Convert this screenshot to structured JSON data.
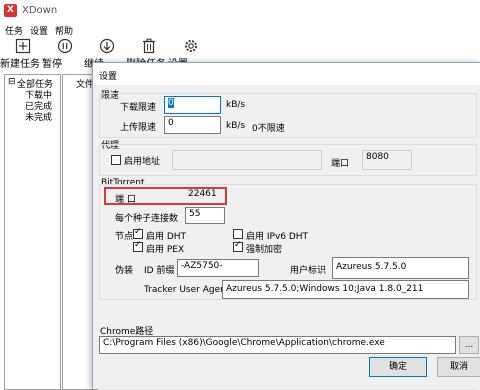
{
  "app": {
    "title": "XDown",
    "logo_letter": "X"
  },
  "menu": [
    "任务",
    "设置",
    "帮助"
  ],
  "toolbar": [
    {
      "label": "新建任务",
      "icon": "plus-icon"
    },
    {
      "label": "暂停",
      "icon": "pause-icon"
    },
    {
      "label": "继续",
      "icon": "download-icon"
    },
    {
      "label": "删除任务",
      "icon": "trash-icon"
    },
    {
      "label": "设置",
      "icon": "gear-icon"
    }
  ],
  "tree": {
    "root": "全部任务",
    "items": [
      "下载中",
      "已完成",
      "未完成"
    ]
  },
  "list": {
    "column_header": "文件"
  },
  "dialog": {
    "title": "设置",
    "speed_limit": {
      "group": "限速",
      "download_label": "下载限速",
      "download_value": "0",
      "download_unit": "kB/s",
      "upload_label": "上传限速",
      "upload_value": "0",
      "upload_unit": "kB/s",
      "unlimited_note": "0不限速"
    },
    "proxy": {
      "group": "代理",
      "enable_label": "启用地址",
      "enabled": false,
      "address_value": "",
      "port_label": "端口",
      "port_value": "8080"
    },
    "bittorrent": {
      "group": "BitTorrent",
      "port_label": "端 口",
      "port_value": "22461",
      "per_seed_label": "每个种子连接数",
      "per_seed_value": "55",
      "nodes_label": "节点",
      "options": [
        {
          "label": "启用 DHT",
          "checked": true
        },
        {
          "label": "启用 IPv6 DHT",
          "checked": false
        },
        {
          "label": "启用 PEX",
          "checked": true
        },
        {
          "label": "强制加密",
          "checked": true
        }
      ],
      "spoof_label": "伪装",
      "id_prefix_label": "ID 前缀",
      "id_prefix_value": "-AZ5750-",
      "user_agent_label": "用户标识",
      "user_agent_value": "Azureus 5.7.5.0",
      "tracker_ua_label": "Tracker User Agent",
      "tracker_ua_value": "Azureus 5.7.5.0;Windows 10;Java 1.8.0_211"
    },
    "chrome": {
      "label": "Chrome路径",
      "path_value": "C:\\Program Files (x86)\\Google\\Chrome\\Application\\chrome.exe",
      "browse_label": "..."
    },
    "ok_label": "确定",
    "cancel_label": "取消"
  },
  "colors": {
    "accent": "#0078d7",
    "highlight_box": "#d83a3a"
  }
}
